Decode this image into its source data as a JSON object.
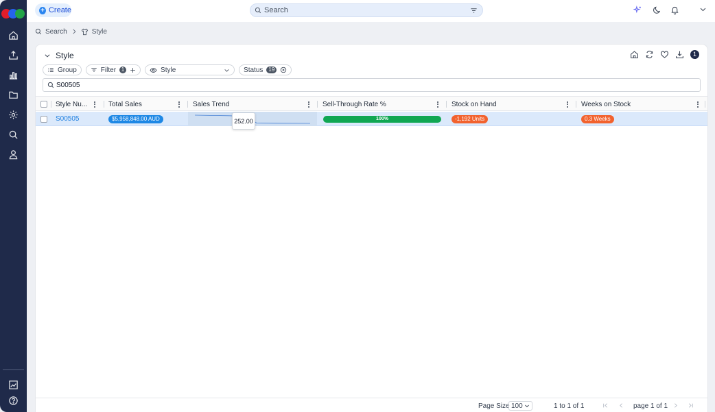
{
  "topbar": {
    "create_label": "Create",
    "search_placeholder": "Search"
  },
  "breadcrumb": {
    "items": [
      "Search",
      "Style"
    ]
  },
  "card": {
    "title": "Style",
    "notification_count": "1"
  },
  "chips": {
    "group_label": "Group",
    "filter_label": "Filter",
    "filter_count": "1",
    "view_label": "Style",
    "status_label": "Status",
    "status_count": "19"
  },
  "filter_input": {
    "value": "S00505"
  },
  "columns": [
    "Style Nu...",
    "Total Sales",
    "Sales Trend",
    "Sell-Through Rate %",
    "Stock on Hand",
    "Weeks on Stock"
  ],
  "rows": [
    {
      "style_number": "S00505",
      "total_sales": "$5,958,848.00 AUD",
      "sell_through": "100%",
      "sell_through_fraction": 1.0,
      "stock_on_hand": "-1,192 Units",
      "weeks_on_stock": "0.3 Weeks"
    }
  ],
  "tooltip": {
    "value": "252.00"
  },
  "footer": {
    "page_size_label": "Page Size",
    "page_size_value": "100",
    "range": "1 to 1 of 1",
    "page_info": "page 1 of 1"
  },
  "colors": {
    "sidebar": "#1f2a4a",
    "accent": "#2a85f0",
    "row_selected": "#dbe9fb",
    "sales_pill": "#1e88e5",
    "progress": "#10a753",
    "warning_pill": "#f2622e",
    "logo": [
      "#e11d2a",
      "#2563eb",
      "#22a447"
    ]
  },
  "icons": {
    "sidebar": [
      "home-icon",
      "upload-icon",
      "bar-chart-icon",
      "folder-icon",
      "settings-icon",
      "search-icon",
      "user-icon"
    ],
    "sidebar_bottom": [
      "report-chart-icon",
      "help-icon"
    ],
    "topbar": [
      "sparkle-icon",
      "moon-icon",
      "bell-icon",
      "chevron-down-icon"
    ],
    "card_actions": [
      "home-icon",
      "refresh-icon",
      "heart-icon",
      "download-icon"
    ]
  }
}
